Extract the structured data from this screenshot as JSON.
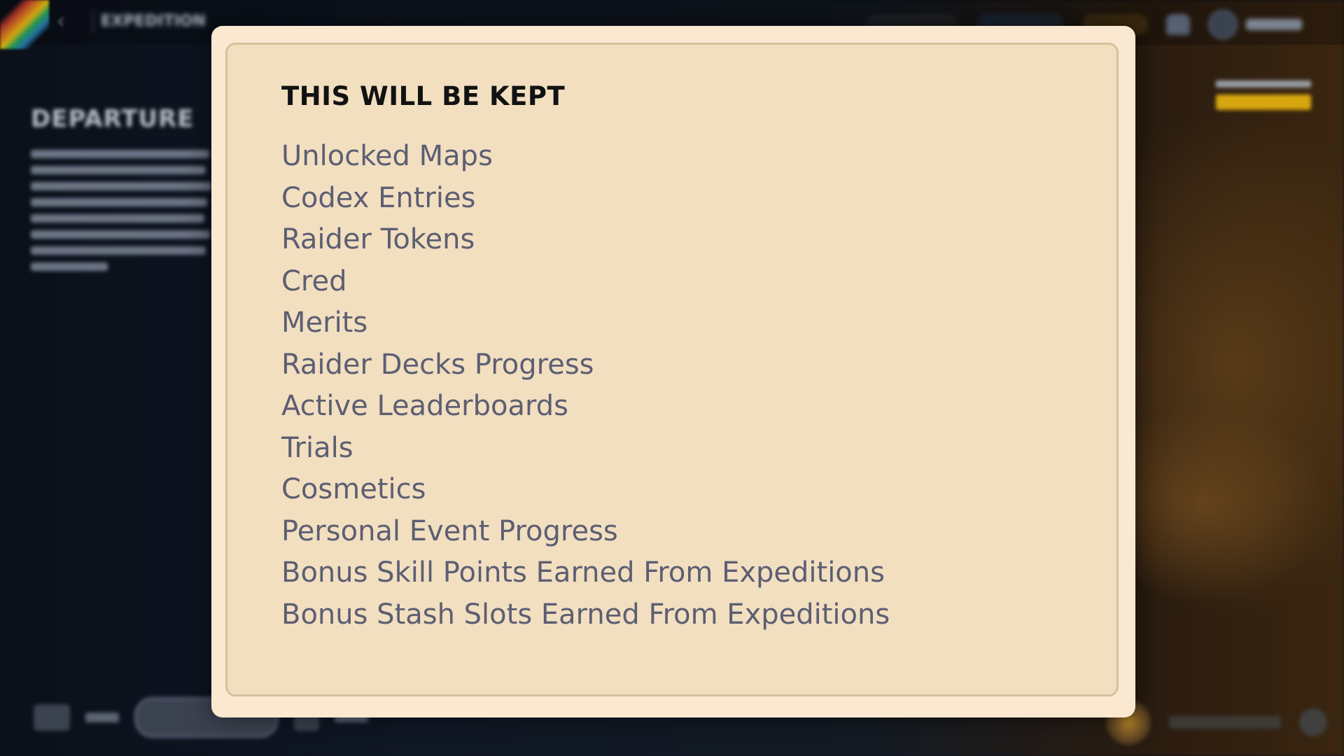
{
  "background": {
    "screen_title": "EXPEDITION",
    "section_title": "DEPARTURE"
  },
  "modal": {
    "title": "THIS WILL BE KEPT",
    "items": [
      "Unlocked Maps",
      "Codex Entries",
      "Raider Tokens",
      "Cred",
      "Merits",
      "Raider Decks Progress",
      "Active Leaderboards",
      "Trials",
      "Cosmetics",
      "Personal Event Progress",
      "Bonus Skill Points Earned From Expeditions",
      "Bonus Stash Slots Earned From Expeditions"
    ]
  },
  "icons": {
    "back": "chevron-left-icon",
    "notifications": "bell-icon",
    "profile": "avatar-icon"
  },
  "colors": {
    "modal_outer": "#fbe8d0",
    "modal_inner": "#f1dfc0",
    "modal_border": "#d6bf9c",
    "title_text": "#121212",
    "item_text": "#5d5e73",
    "accent_gold": "#d7a60f",
    "accent_blue": "#2f8dd6"
  }
}
